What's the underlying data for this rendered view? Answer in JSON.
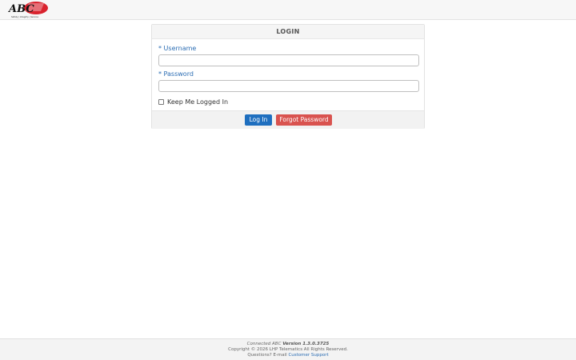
{
  "brand": {
    "logo_text": "ABC",
    "logo_tagline": "Safety | Integrity | Service",
    "accent_color": "#d9232e"
  },
  "login": {
    "title": "LOGIN",
    "username_label": "Username",
    "password_label": "Password",
    "required_marker": "*",
    "username_value": "",
    "password_value": "",
    "remember_label": "Keep Me Logged In",
    "remember_checked": false,
    "login_button": "Log In",
    "forgot_button": "Forgot Password"
  },
  "footer": {
    "product_prefix": "Connected ",
    "product_brand": "ABC",
    "version": "Version 1.3.0.3725",
    "copyright": "Copyright © 2026 LHP Telematics All Rights Reserved.",
    "questions": "Questions? E-mail ",
    "support_link": "Customer Support"
  }
}
